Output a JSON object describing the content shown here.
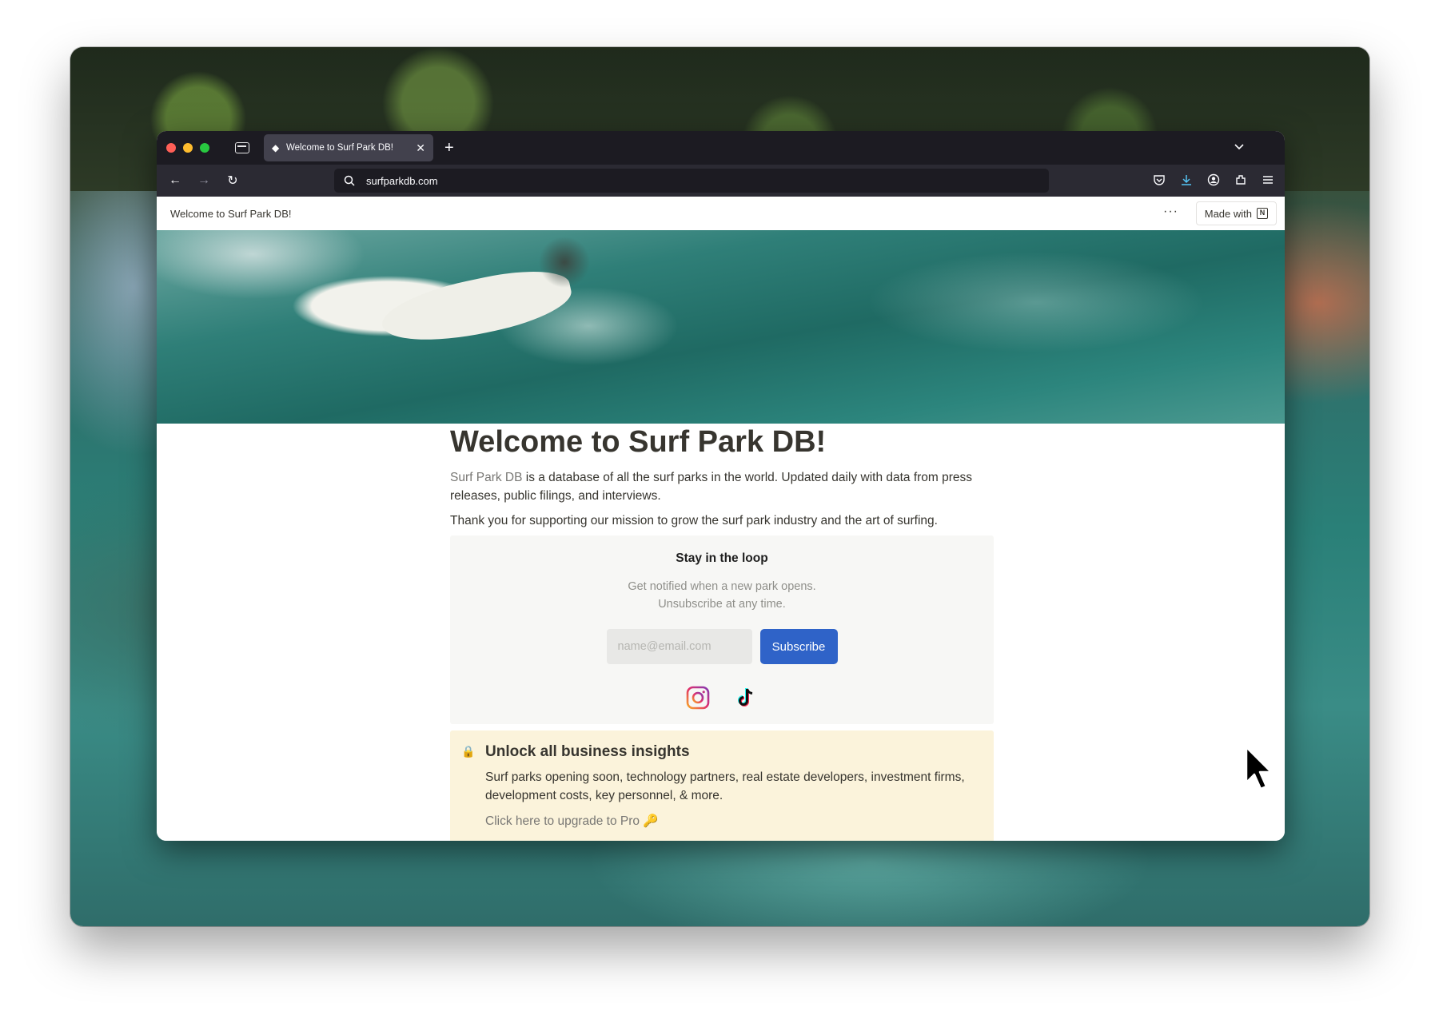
{
  "browser": {
    "tab_title": "Welcome to Surf Park DB!",
    "url": "surfparkdb.com"
  },
  "notion": {
    "breadcrumb": "Welcome to Surf Park DB!",
    "more": "···",
    "made_with": "Made with",
    "notion_logo": "N"
  },
  "article": {
    "title": "Welcome to Surf Park DB!",
    "intro_link": "Surf Park DB",
    "intro_rest": " is a database of all the surf parks in the world. Updated daily with data from press releases, public filings, and interviews.",
    "thanks": "Thank you for supporting our mission to grow the surf park industry and the art of surfing."
  },
  "newsletter": {
    "title": "Stay in the loop",
    "desc_line1": "Get notified when a new park opens.",
    "desc_line2": "Unsubscribe at any time.",
    "email_placeholder": "name@email.com",
    "subscribe_label": "Subscribe",
    "socials": [
      "instagram-icon",
      "tiktok-icon"
    ]
  },
  "insights": {
    "icon": "🔒",
    "title": "Unlock all business insights",
    "body": "Surf parks opening soon, technology partners, real estate developers, investment firms, development costs, key personnel, & more.",
    "link": "Click here to upgrade to Pro 🔑"
  },
  "colors": {
    "accent": "#2f63c8",
    "loop_bg": "#f7f7f5",
    "insights_bg": "#fbf3db"
  }
}
